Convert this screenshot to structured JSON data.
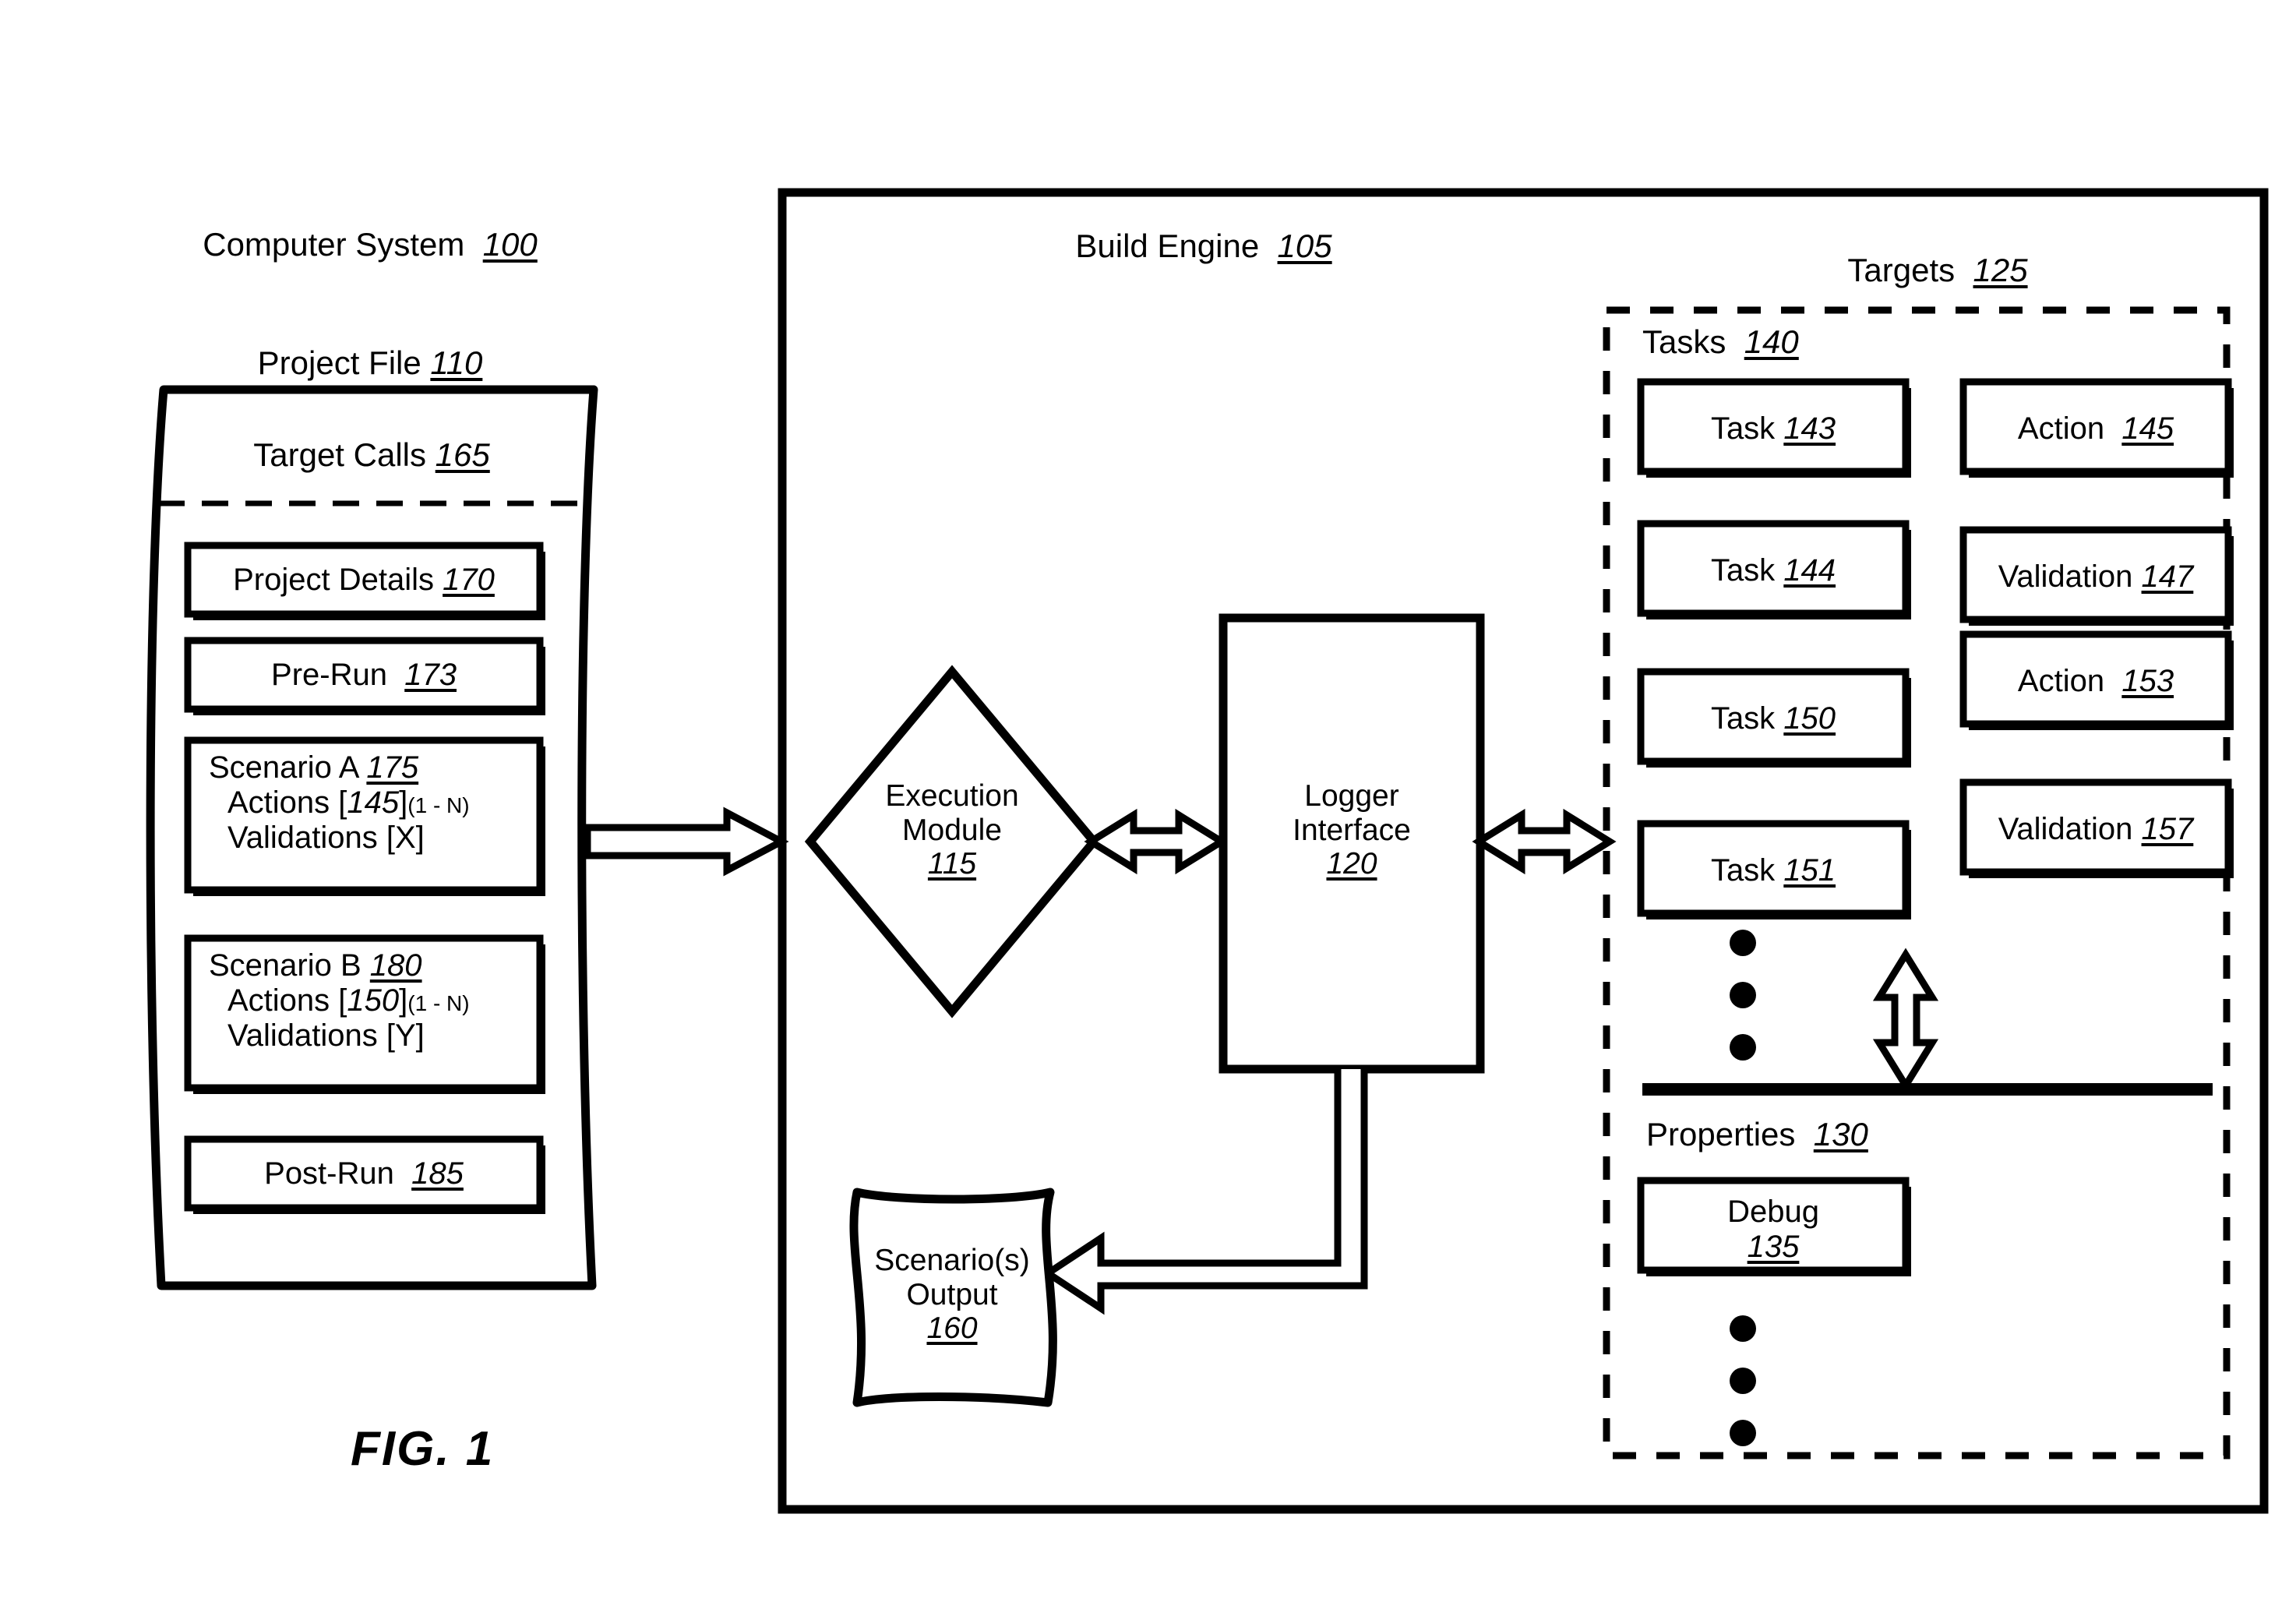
{
  "figure": {
    "caption": "FIG. 1",
    "system_title": "Computer System",
    "system_ref": "100"
  },
  "project_file": {
    "title": "Project File",
    "title_ref": "110",
    "header": "Target Calls",
    "header_ref": "165",
    "items": [
      {
        "label": "Project Details",
        "ref": "170",
        "lines": []
      },
      {
        "label": "Pre-Run",
        "ref": "173",
        "lines": []
      },
      {
        "label": "Scenario A",
        "ref": "175",
        "lines": [
          "Actions [145](1 - N)",
          "Validations [X]"
        ],
        "line1_pre": "Actions [",
        "line1_num": "145",
        "line1_post": "]",
        "line1_sub": "(1 - N)",
        "line2": "Validations [X]"
      },
      {
        "label": "Scenario B",
        "ref": "180",
        "lines": [
          "Actions [150](1 - N)",
          "Validations [Y]"
        ],
        "line1_pre": "Actions [",
        "line1_num": "150",
        "line1_post": "]",
        "line1_sub": "(1 - N)",
        "line2": "Validations [Y]"
      },
      {
        "label": "Post-Run",
        "ref": "185",
        "lines": []
      }
    ]
  },
  "build_engine": {
    "title": "Build Engine",
    "title_ref": "105",
    "execution_module": {
      "line1": "Execution",
      "line2": "Module",
      "ref": "115"
    },
    "logger_interface": {
      "line1": "Logger",
      "line2": "Interface",
      "ref": "120"
    },
    "scenario_output": {
      "line1": "Scenario(s)",
      "line2": "Output",
      "ref": "160"
    }
  },
  "targets": {
    "title": "Targets",
    "title_ref": "125",
    "tasks_title": "Tasks",
    "tasks_ref": "140",
    "rows": [
      {
        "task": "Task",
        "task_ref": "143",
        "pair": "Action",
        "pair_ref": "145"
      },
      {
        "task": "Task",
        "task_ref": "144",
        "pair": "Validation",
        "pair_ref": "147"
      },
      {
        "task": "Task",
        "task_ref": "150",
        "pair": "Action",
        "pair_ref": "153"
      },
      {
        "task": "Task",
        "task_ref": "151",
        "pair": "Validation",
        "pair_ref": "157"
      }
    ],
    "properties_title": "Properties",
    "properties_ref": "130",
    "properties": [
      {
        "label": "Debug",
        "ref": "135"
      }
    ]
  },
  "colors": {
    "ink": "#000000",
    "paper": "#ffffff"
  }
}
